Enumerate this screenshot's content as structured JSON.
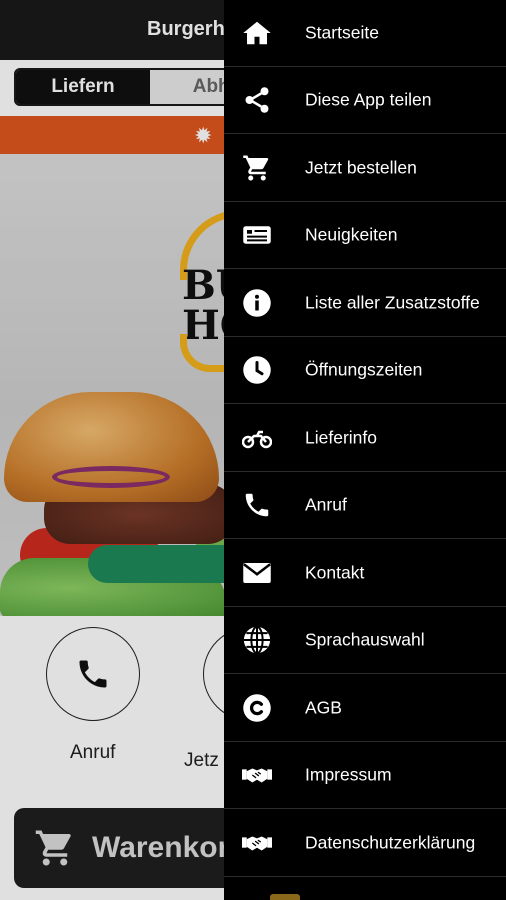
{
  "app": {
    "title": "Burgerho",
    "toggle": {
      "deliver_label": "Liefern",
      "pickup_label": "Abho"
    },
    "logo_text": "BU\nHC",
    "quick_actions": [
      {
        "label": "Anruf",
        "icon": "phone-icon"
      },
      {
        "label": "Jetz",
        "icon": "cart-icon"
      }
    ],
    "cart_label": "Warenkorl"
  },
  "drawer": {
    "items": [
      {
        "label": "Startseite",
        "icon": "home-icon"
      },
      {
        "label": "Diese App teilen",
        "icon": "share-icon"
      },
      {
        "label": "Jetzt bestellen",
        "icon": "cart-icon"
      },
      {
        "label": "Neuigkeiten",
        "icon": "news-icon"
      },
      {
        "label": "Liste aller Zusatzstoffe",
        "icon": "info-icon"
      },
      {
        "label": "Öffnungszeiten",
        "icon": "clock-icon"
      },
      {
        "label": "Lieferinfo",
        "icon": "motorcycle-icon"
      },
      {
        "label": "Anruf",
        "icon": "phone-icon"
      },
      {
        "label": "Kontakt",
        "icon": "envelope-icon"
      },
      {
        "label": "Sprachauswahl",
        "icon": "globe-icon"
      },
      {
        "label": "AGB",
        "icon": "copyright-icon"
      },
      {
        "label": "Impressum",
        "icon": "handshake-icon"
      },
      {
        "label": "Datenschutzerklärung",
        "icon": "handshake-icon"
      }
    ]
  },
  "colors": {
    "drawer_bg": "#000000",
    "banner_orange": "#e0561e",
    "logo_yellow": "#f2b21c",
    "order_green": "#1f8a5b"
  }
}
